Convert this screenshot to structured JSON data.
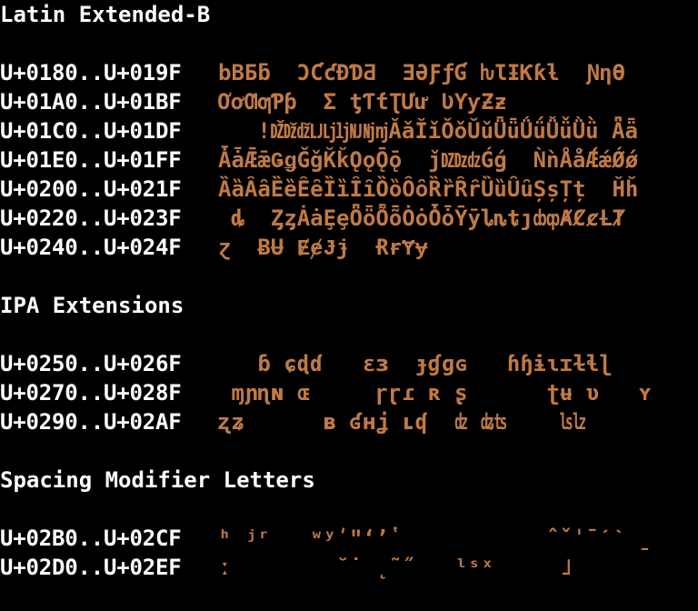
{
  "sections": [
    {
      "title": "Latin Extended-B",
      "rows": [
        {
          "range": "U+0180..U+019F",
          "glyphs": "bBƂƃ  ƆƇƈƉƊƋ  ƎƏƑƒƓ ƕƖƗƘƙƚ  ƝƞƟ"
        },
        {
          "range": "U+01A0..U+01BF",
          "glyphs": "ƠơƢƣƤƥ  Ʃ ƫƬƭƮƯư ƲƳƴƵƶ"
        },
        {
          "range": "U+01C0..U+01DF",
          "glyphs": "   ǃǄǅǆǇǈǉǊǋǌǍǎǏǐǑǒǓǔǕǖǗǘǙǚǛǜ Ǟǟ"
        },
        {
          "range": "U+01E0..U+01FF",
          "glyphs": "ǠǡǢǣǤǥǦǧǨǩǪǫǬǭ  ǰǱǲǳǴǵ  ǸǹǺǻǼǽǾǿ"
        },
        {
          "range": "U+0200..U+021F",
          "glyphs": "ȀȁȂȃȄȅȆȇȈȉȊȋȌȍȎȏȐȑȒȓȔȕȖȗȘșȚț  Ȟȟ"
        },
        {
          "range": "U+0220..U+023F",
          "glyphs": " ȡ  ȤȥȦȧȨȩȪȫȬȭȮȯȰȱȲȳȴȵȶȷȸȹȺȻȼȽȾ"
        },
        {
          "range": "U+0240..U+024F",
          "glyphs": "ɀ  ɃɄ ɆɇɈɉ  ɌɍɎɏ"
        }
      ]
    },
    {
      "title": "IPA Extensions",
      "rows": [
        {
          "range": "U+0250..U+026F",
          "glyphs": "   ɓ ɕɖɗ   ɛɜ  ɟɠɡɢ   ɦɧɨɩɪɫɬɭ"
        },
        {
          "range": "U+0270..U+028F",
          "glyphs": " ɱɲɳɴ ɶ     ɼɽɾ ʀ ʂ      ʈʉ ʋ   ʏ"
        },
        {
          "range": "U+0290..U+02AF",
          "glyphs": "ʐʑ      ʙ ʛʜʝ ʟʠ  ʣ ʥʦ    ʪʫ"
        }
      ]
    },
    {
      "title": "Spacing Modifier Letters",
      "rows": [
        {
          "range": "U+02B0..U+02CF",
          "glyphs": "ʰ ʲʳ   ʷʸʹʺʻʼʽ           ˆˇˈˉˊˋ ˍ"
        },
        {
          "range": "U+02D0..U+02EF",
          "glyphs": "ː        ˘˙ ˛˜˝   ˡˢˣ     ˩"
        }
      ]
    }
  ],
  "colors": {
    "background": "#000000",
    "text": "#ffffff",
    "glyph": "#c07a44"
  }
}
